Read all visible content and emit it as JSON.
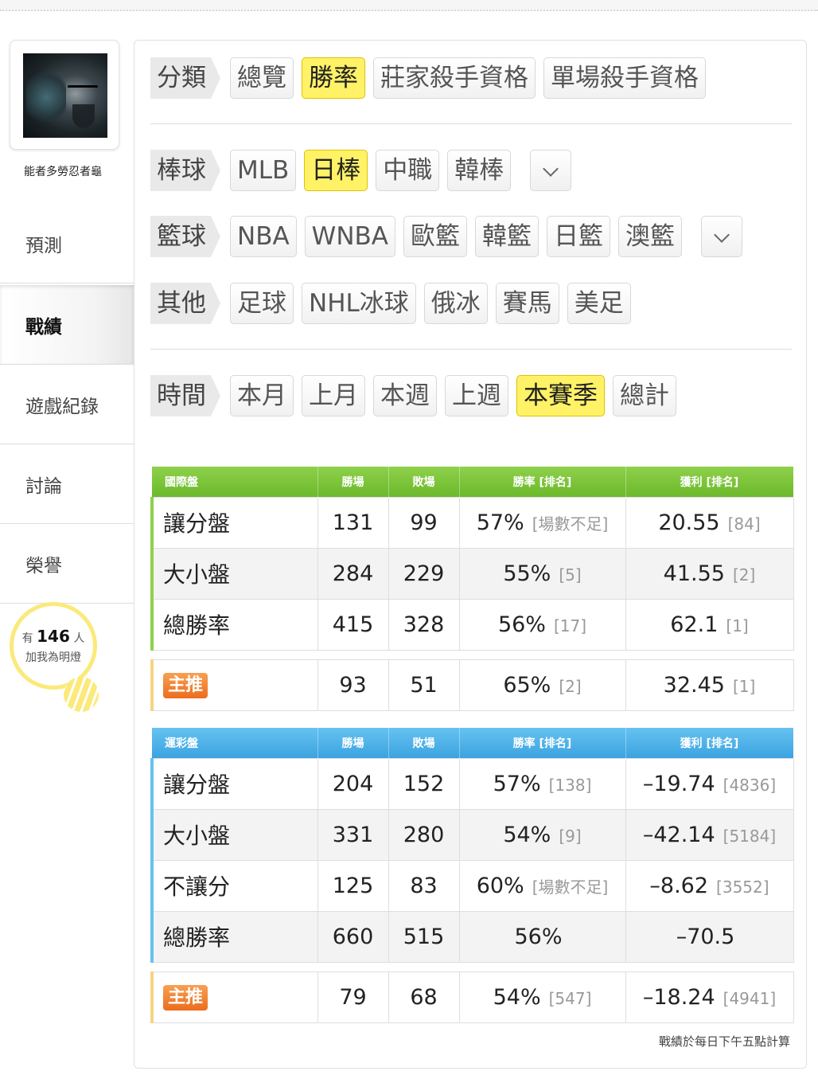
{
  "user": {
    "name": "能者多勞忍者龜"
  },
  "sidebar": {
    "items": [
      {
        "label": "預測"
      },
      {
        "label": "戰績"
      },
      {
        "label": "遊戲紀錄"
      },
      {
        "label": "討論"
      },
      {
        "label": "榮譽"
      }
    ],
    "active_index": 1
  },
  "fans": {
    "prefix": "有",
    "count": "146",
    "unit": "人",
    "caption": "加我為明燈"
  },
  "filters": {
    "category": {
      "tag": "分類",
      "options": [
        "總覽",
        "勝率",
        "莊家殺手資格",
        "單場殺手資格"
      ],
      "selected": "勝率"
    },
    "baseball": {
      "tag": "棒球",
      "options": [
        "MLB",
        "日棒",
        "中職",
        "韓棒"
      ],
      "selected": "日棒"
    },
    "basketball": {
      "tag": "籃球",
      "options": [
        "NBA",
        "WNBA",
        "歐籃",
        "韓籃",
        "日籃",
        "澳籃"
      ]
    },
    "other": {
      "tag": "其他",
      "options": [
        "足球",
        "NHL冰球",
        "俄冰",
        "賽馬",
        "美足"
      ]
    },
    "time": {
      "tag": "時間",
      "options": [
        "本月",
        "上月",
        "本週",
        "上週",
        "本賽季",
        "總計"
      ],
      "selected": "本賽季"
    }
  },
  "intl": {
    "headers": [
      "國際盤",
      "勝場",
      "敗場",
      "勝率 [排名]",
      "獲利 [排名]"
    ],
    "rows": [
      {
        "label": "讓分盤",
        "win": "131",
        "loss": "99",
        "rate": "57%",
        "rate_rank": "[場數不足]",
        "profit": "20.55",
        "profit_rank": "[84]"
      },
      {
        "label": "大小盤",
        "win": "284",
        "loss": "229",
        "rate": "55%",
        "rate_rank": "[5]",
        "profit": "41.55",
        "profit_rank": "[2]"
      },
      {
        "label": "總勝率",
        "win": "415",
        "loss": "328",
        "rate": "56%",
        "rate_rank": "[17]",
        "profit": "62.1",
        "profit_rank": "[1]"
      }
    ],
    "main": {
      "label": "主推",
      "win": "93",
      "loss": "51",
      "rate": "65%",
      "rate_rank": "[2]",
      "profit": "32.45",
      "profit_rank": "[1]"
    }
  },
  "lottery": {
    "headers": [
      "運彩盤",
      "勝場",
      "敗場",
      "勝率 [排名]",
      "獲利 [排名]"
    ],
    "rows": [
      {
        "label": "讓分盤",
        "win": "204",
        "loss": "152",
        "rate": "57%",
        "rate_rank": "[138]",
        "profit": "–19.74",
        "profit_rank": "[4836]"
      },
      {
        "label": "大小盤",
        "win": "331",
        "loss": "280",
        "rate": "54%",
        "rate_rank": "[9]",
        "profit": "–42.14",
        "profit_rank": "[5184]"
      },
      {
        "label": "不讓分",
        "win": "125",
        "loss": "83",
        "rate": "60%",
        "rate_rank": "[場數不足]",
        "profit": "–8.62",
        "profit_rank": "[3552]"
      },
      {
        "label": "總勝率",
        "win": "660",
        "loss": "515",
        "rate": "56%",
        "rate_rank": "",
        "profit": "–70.5",
        "profit_rank": ""
      }
    ],
    "main": {
      "label": "主推",
      "win": "79",
      "loss": "68",
      "rate": "54%",
      "rate_rank": "[547]",
      "profit": "–18.24",
      "profit_rank": "[4941]"
    }
  },
  "footnote": "戰績於每日下午五點計算",
  "colors": {
    "highlight": "#fff266",
    "intl_header": "#7dc43a",
    "lottery_header": "#4fb0e8",
    "badge": "#ec6d1c"
  }
}
